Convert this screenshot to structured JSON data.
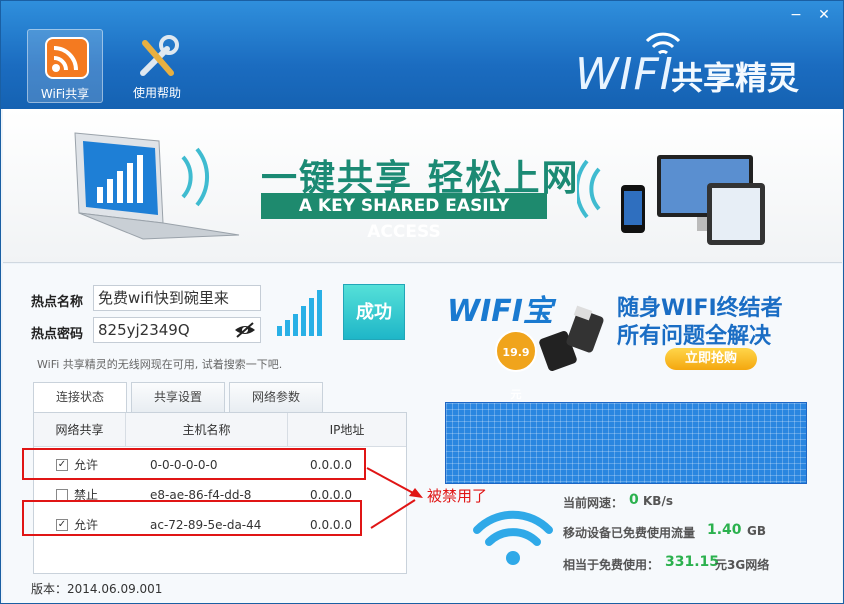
{
  "header": {
    "tools": [
      {
        "label": "WiFi共享",
        "icon": "wifi-share-icon"
      },
      {
        "label": "使用帮助",
        "icon": "tools-icon"
      }
    ],
    "logo_wifi": "WIFI",
    "logo_cn": "共享精灵",
    "window_controls": {
      "minimize": "−",
      "close": "✕"
    }
  },
  "banner": {
    "title": "一键共享 轻松上网",
    "subtitle": "A KEY SHARED EASILY ACCESS"
  },
  "hotspot": {
    "name_label": "热点名称",
    "name_value": "免费wifi快到碗里来",
    "password_label": "热点密码",
    "password_value": "825yj2349Q",
    "status_button": "成功",
    "hint": "WiFi 共享精灵的无线网现在可用, 试着搜索一下吧."
  },
  "tabs": [
    {
      "label": "连接状态",
      "active": true
    },
    {
      "label": "共享设置",
      "active": false
    },
    {
      "label": "网络参数",
      "active": false
    }
  ],
  "table": {
    "headers": [
      "网络共享",
      "主机名称",
      "IP地址"
    ],
    "rows": [
      {
        "checked": true,
        "share": "允许",
        "host": "0-0-0-0-0-0",
        "ip": "0.0.0.0"
      },
      {
        "checked": false,
        "share": "禁止",
        "host": "e8-ae-86-f4-dd-8",
        "ip": "0.0.0.0"
      },
      {
        "checked": true,
        "share": "允许",
        "host": "ac-72-89-5e-da-44",
        "ip": "0.0.0.0"
      }
    ]
  },
  "annotation": "被禁用了",
  "version": "版本：2014.06.09.001",
  "ad": {
    "brand": "WIFI宝",
    "price": "19.9元",
    "line1": "随身WIFI终结者",
    "line2": "所有问题全解决",
    "buy": "立即抢购"
  },
  "stats": {
    "speed_label": "当前网速：",
    "speed_value": "0",
    "speed_unit": "KB/s",
    "traffic_label": "移动设备已免费使用流量",
    "traffic_value": "1.40",
    "traffic_unit": "GB",
    "equiv_label": "相当于免费使用：",
    "equiv_value": "331.15",
    "equiv_unit": "元3G网络"
  }
}
